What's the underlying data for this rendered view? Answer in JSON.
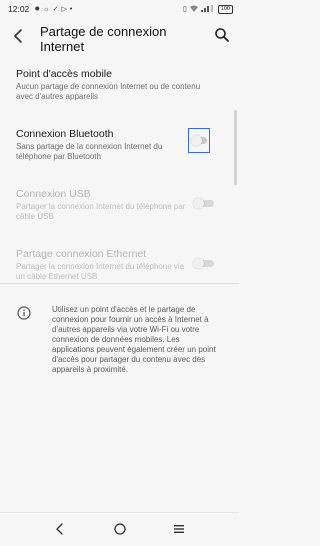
{
  "status_bar": {
    "time": "12:02",
    "icons_left": [
      "gear-icon",
      "sun-icon",
      "check-icon",
      "cast-icon",
      "dot-icon"
    ],
    "icons_right": [
      "vibrate-icon",
      "wifi-icon",
      "signal-icon"
    ],
    "battery": "100"
  },
  "header": {
    "title": "Partage de connexion Internet",
    "back_icon": "arrow-left-icon",
    "search_icon": "search-icon"
  },
  "settings": [
    {
      "title": "Point d'accès mobile",
      "subtitle": "Aucun partage de connexion Internet ou de contenu avec d'autres appareils",
      "enabled": true,
      "has_toggle": false
    },
    {
      "title": "Connexion Bluetooth",
      "subtitle": "Sans partage de la connexion Internet du téléphone par Bluetooth",
      "enabled": true,
      "has_toggle": true,
      "toggle_on": false
    },
    {
      "title": "Connexion USB",
      "subtitle": "Partager la connexion Internet du téléphone par câble USB",
      "enabled": false,
      "has_toggle": true,
      "toggle_on": false
    },
    {
      "title": "Partage connexion Ethernet",
      "subtitle": "Partager la connexion Internet du téléphone via un câble Ethernet USB",
      "enabled": false,
      "has_toggle": true,
      "toggle_on": false
    }
  ],
  "info": {
    "icon": "info-icon",
    "text": "Utilisez un point d'accès et le partage de connexion pour fournir un accès à Internet à d'autres appareils via votre Wi-Fi ou votre connexion de données mobiles. Les applications peuvent également créer un point d'accès pour partager du contenu avec des appareils à proximité."
  },
  "nav": {
    "back_icon": "nav-back-icon",
    "home_icon": "nav-home-icon",
    "recents_icon": "nav-recents-icon"
  },
  "colors": {
    "background": "#f6f6f6",
    "focus_outline": "#3a6bd8",
    "disabled_text": "#b5b5b5"
  }
}
